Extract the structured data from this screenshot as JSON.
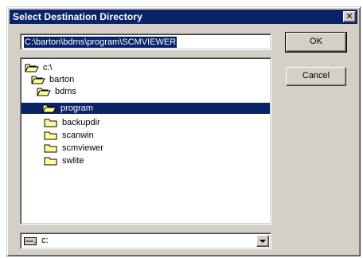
{
  "window": {
    "title": "Select Destination Directory",
    "close_glyph": "✕"
  },
  "path_field": {
    "value": "C:\\barton\\bdms\\program\\SCMVIEWER"
  },
  "directory_tree": [
    {
      "label": "c:\\",
      "icon": "open-folder-icon",
      "selected": false
    },
    {
      "label": "barton",
      "icon": "open-folder-icon",
      "selected": false
    },
    {
      "label": "bdms",
      "icon": "open-folder-icon",
      "selected": false
    },
    {
      "label": "program",
      "icon": "open-folder-icon",
      "selected": true
    },
    {
      "label": "backupdir",
      "icon": "folder-icon",
      "selected": false
    },
    {
      "label": "scanwin",
      "icon": "folder-icon",
      "selected": false
    },
    {
      "label": "scmviewer",
      "icon": "folder-icon",
      "selected": false
    },
    {
      "label": "swlite",
      "icon": "folder-icon",
      "selected": false
    }
  ],
  "drive_select": {
    "value": "c:",
    "icon": "drive-icon"
  },
  "buttons": {
    "ok_label": "OK",
    "cancel_label": "Cancel"
  },
  "colors": {
    "titlebar": "#0a246a",
    "selection": "#0a246a",
    "face": "#d4d0c8",
    "folder": "#ffff99"
  }
}
